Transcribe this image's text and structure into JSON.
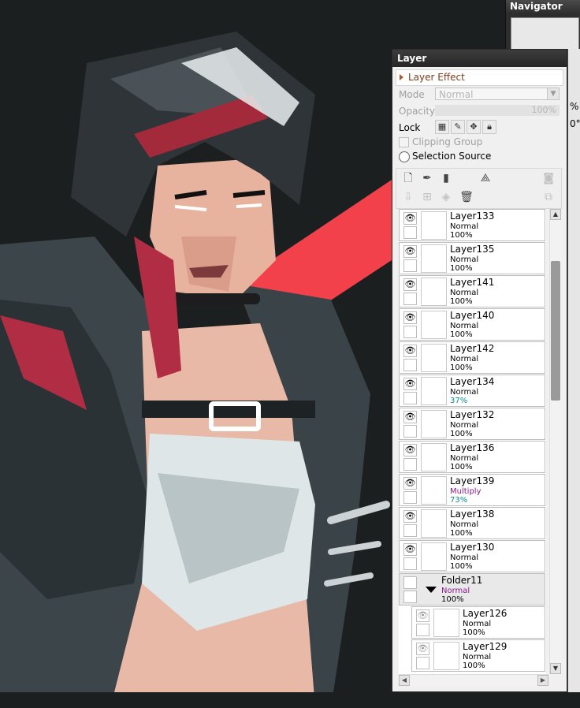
{
  "navigator": {
    "title": "Navigator"
  },
  "layer_panel": {
    "title": "Layer",
    "layer_effect_label": "Layer Effect",
    "mode_label": "Mode",
    "mode_value": "Normal",
    "opacity_label": "Opacity",
    "opacity_value": "100%",
    "lock_label": "Lock",
    "clipping_group_label": "Clipping Group",
    "selection_source_label": "Selection Source"
  },
  "right_strip": {
    "frag1": "%",
    "frag2": "0°"
  },
  "layers": [
    {
      "name": "Layer133",
      "mode": "Normal",
      "opacity": "100%"
    },
    {
      "name": "Layer135",
      "mode": "Normal",
      "opacity": "100%"
    },
    {
      "name": "Layer141",
      "mode": "Normal",
      "opacity": "100%"
    },
    {
      "name": "Layer140",
      "mode": "Normal",
      "opacity": "100%"
    },
    {
      "name": "Layer142",
      "mode": "Normal",
      "opacity": "100%"
    },
    {
      "name": "Layer134",
      "mode": "Normal",
      "opacity": "37%"
    },
    {
      "name": "Layer132",
      "mode": "Normal",
      "opacity": "100%"
    },
    {
      "name": "Layer136",
      "mode": "Normal",
      "opacity": "100%"
    },
    {
      "name": "Layer139",
      "mode": "Multiply",
      "opacity": "73%"
    },
    {
      "name": "Layer138",
      "mode": "Normal",
      "opacity": "100%"
    },
    {
      "name": "Layer130",
      "mode": "Normal",
      "opacity": "100%"
    },
    {
      "name": "Folder11",
      "mode": "Normal",
      "opacity": "100%"
    },
    {
      "name": "Layer126",
      "mode": "Normal",
      "opacity": "100%"
    },
    {
      "name": "Layer129",
      "mode": "Normal",
      "opacity": "100%"
    }
  ],
  "colors": {
    "canvas_bg": "#1b1f20",
    "accent_red": "#f2414b",
    "multiply_mode": "#8b1a8b",
    "reduced_opacity": "#0a8c8c"
  }
}
